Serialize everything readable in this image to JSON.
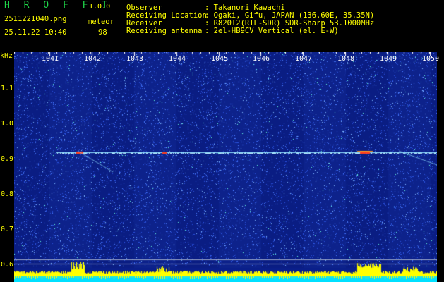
{
  "header": {
    "app_name": "H R O F F T",
    "version": "1.0.0",
    "filename": "2511221040.png",
    "timestamp": "25.11.22 10:40",
    "mode_label": "meteor",
    "count": "98",
    "info": [
      {
        "key": "Observer",
        "value": ": Takanori Kawachi"
      },
      {
        "key": "Receiving Location",
        "value": ": Ogaki, Gifu, JAPAN (136.60E, 35.35N)"
      },
      {
        "key": "Receiver",
        "value": ": R820T2(RTL-SDR) SDR-Sharp 53.1000MHz"
      },
      {
        "key": "Receiving antenna",
        "value": ": 2el-HB9CV Vertical (el. E-W)"
      }
    ]
  },
  "axes": {
    "y_unit": "kHz",
    "y_ticks": [
      "1.1",
      "1.0",
      "0.9",
      "0.8",
      "0.7",
      "0.6"
    ],
    "x_ticks": [
      "1041",
      "1042",
      "1043",
      "1044",
      "1045",
      "1046",
      "1047",
      "1048",
      "1049",
      "1050"
    ]
  },
  "colors": {
    "background": "#0a1f8a",
    "noise_light": "#3c6cff",
    "signal_line": "#8fe0ff",
    "hot": "#ff4020",
    "bottom_bar": "#ffff00",
    "cyan_strip": "#00e0ff"
  }
}
